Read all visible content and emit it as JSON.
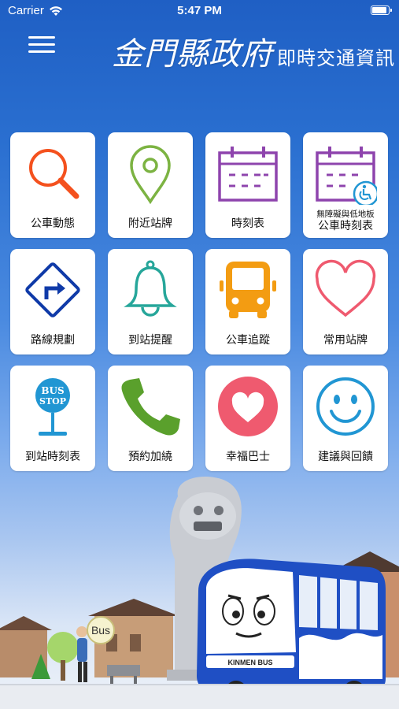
{
  "status_bar": {
    "carrier": "Carrier",
    "time": "5:47 PM"
  },
  "header": {
    "title": "金門縣政府",
    "subtitle": "即時交通資訊"
  },
  "tiles": [
    {
      "label": "公車動態",
      "icon": "search-icon"
    },
    {
      "label": "附近站牌",
      "icon": "map-pin-icon"
    },
    {
      "label": "時刻表",
      "icon": "calendar-icon"
    },
    {
      "label_small": "無障礙與低地板",
      "label_big": "公車時刻表",
      "icon": "accessible-calendar-icon"
    },
    {
      "label": "路線規劃",
      "icon": "route-sign-icon"
    },
    {
      "label": "到站提醒",
      "icon": "bell-icon"
    },
    {
      "label": "公車追蹤",
      "icon": "bus-icon"
    },
    {
      "label": "常用站牌",
      "icon": "heart-icon"
    },
    {
      "label": "到站時刻表",
      "icon": "bus-stop-icon"
    },
    {
      "label": "預約加繞",
      "icon": "phone-icon"
    },
    {
      "label": "幸福巴士",
      "icon": "heart-circle-icon"
    },
    {
      "label": "建議與回饋",
      "icon": "smiley-icon"
    }
  ],
  "scene": {
    "bus_bubble": "Bus",
    "bus_text": "KINMEN BUS",
    "bus_stop_sign": [
      "BUS",
      "STOP"
    ]
  },
  "colors": {
    "orange": "#f4511e",
    "green": "#7cb342",
    "purple": "#8e44ad",
    "blue": "#0f3aa8",
    "teal": "#26a69a",
    "amber": "#f39c12",
    "pink": "#ef5a6f",
    "sky": "#2196d3"
  }
}
